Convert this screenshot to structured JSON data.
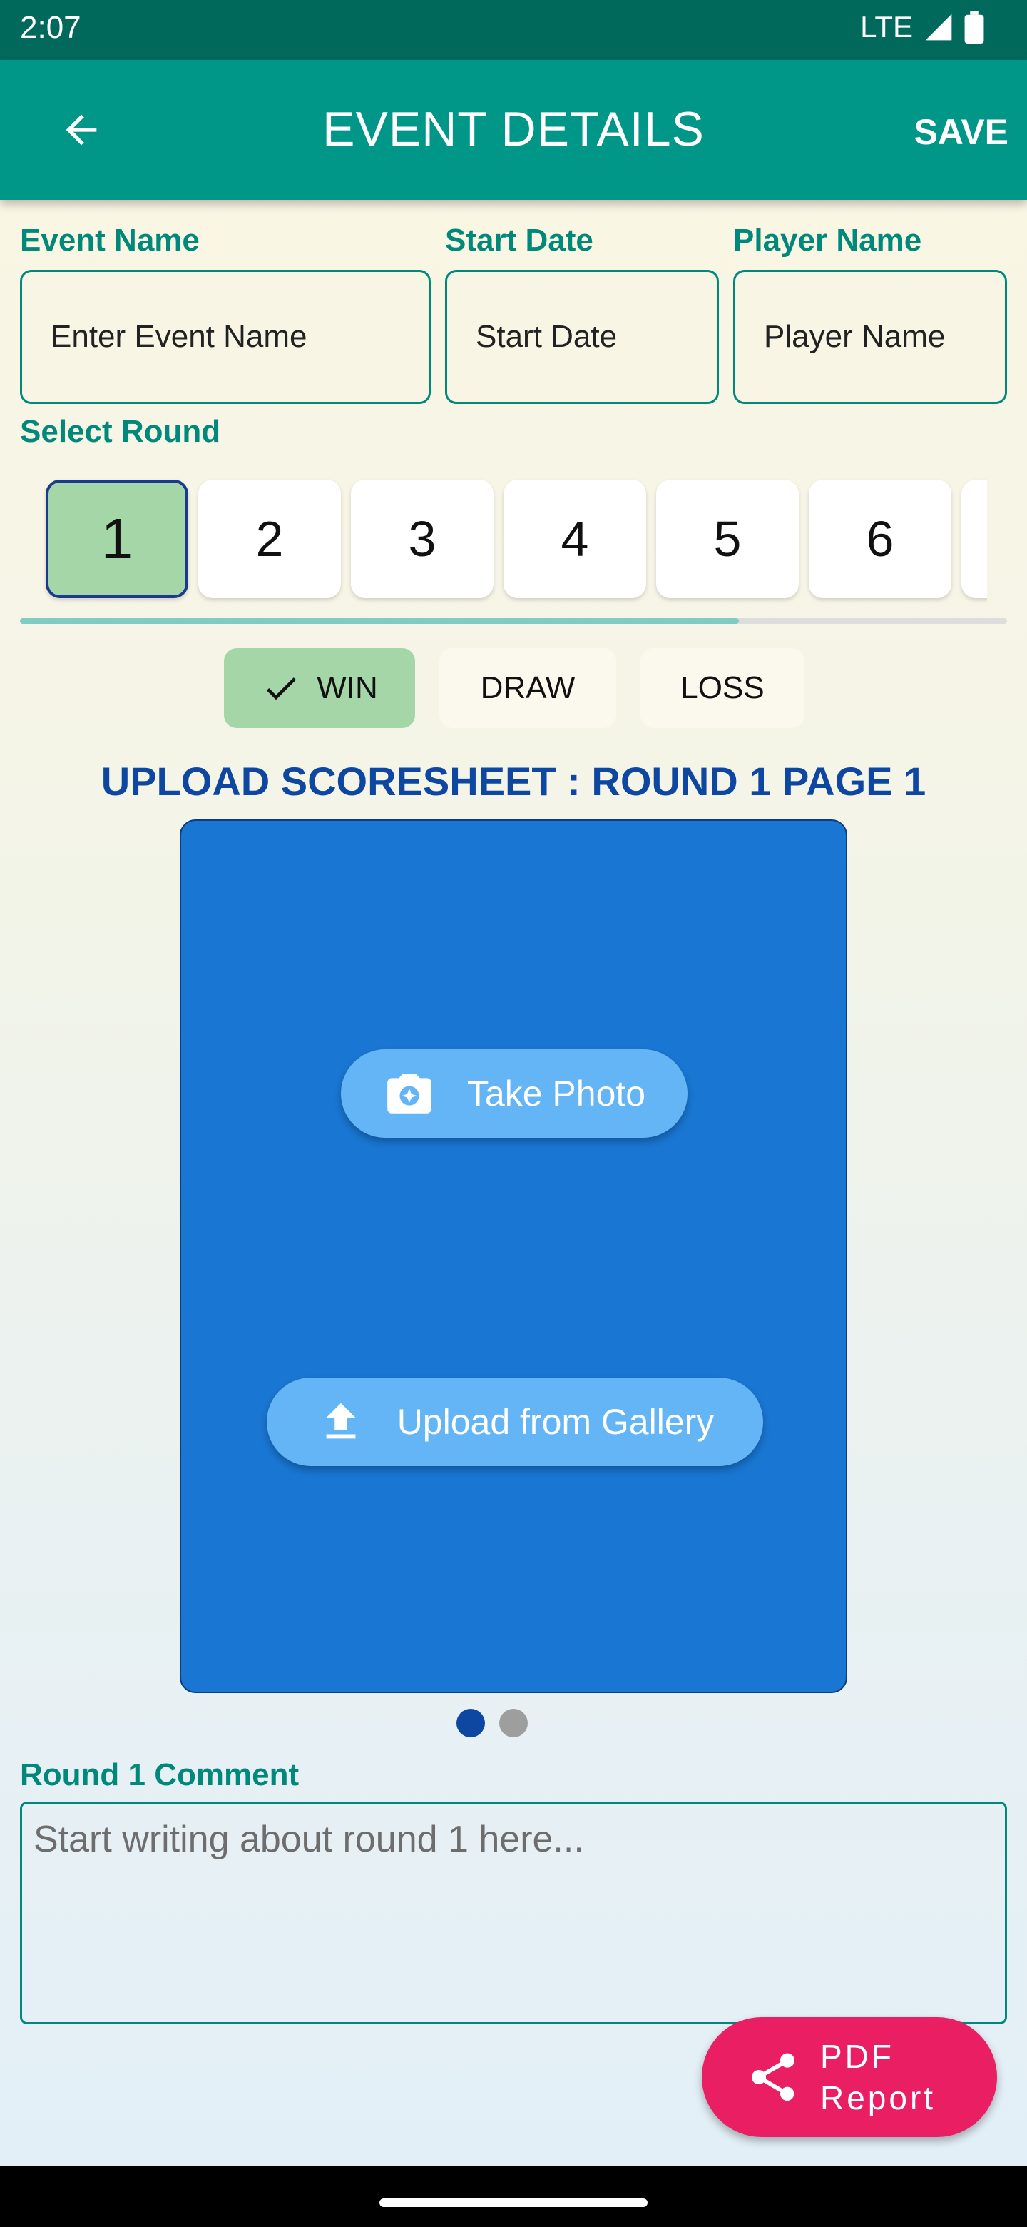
{
  "status": {
    "time": "2:07",
    "network": "LTE"
  },
  "app_bar": {
    "title": "EVENT DETAILS",
    "save_label": "SAVE",
    "back_icon": "arrow-back-icon"
  },
  "form": {
    "event_name": {
      "label": "Event Name",
      "placeholder": "Enter Event Name"
    },
    "start_date": {
      "label": "Start Date",
      "placeholder": "Start Date"
    },
    "player_name": {
      "label": "Player Name",
      "placeholder": "Player Name"
    }
  },
  "rounds": {
    "label": "Select Round",
    "items": [
      "1",
      "2",
      "3",
      "4",
      "5",
      "6"
    ],
    "selected": "1"
  },
  "result": {
    "options": [
      "WIN",
      "DRAW",
      "LOSS"
    ],
    "selected": "WIN"
  },
  "upload": {
    "title": "UPLOAD SCORESHEET : ROUND 1 PAGE 1",
    "take_photo_label": "Take Photo",
    "gallery_label": "Upload from Gallery",
    "page_count": 2,
    "current_page": 1
  },
  "comment": {
    "label": "Round 1 Comment",
    "placeholder": "Start writing about round 1 here..."
  },
  "fab": {
    "line1": "PDF",
    "line2": "Report",
    "icon": "share-icon"
  },
  "colors": {
    "primary": "#009688",
    "primary_dark": "#00695c",
    "accent": "#e91e63",
    "upload_card": "#1976d2",
    "win_selected": "#a5d6a7"
  }
}
